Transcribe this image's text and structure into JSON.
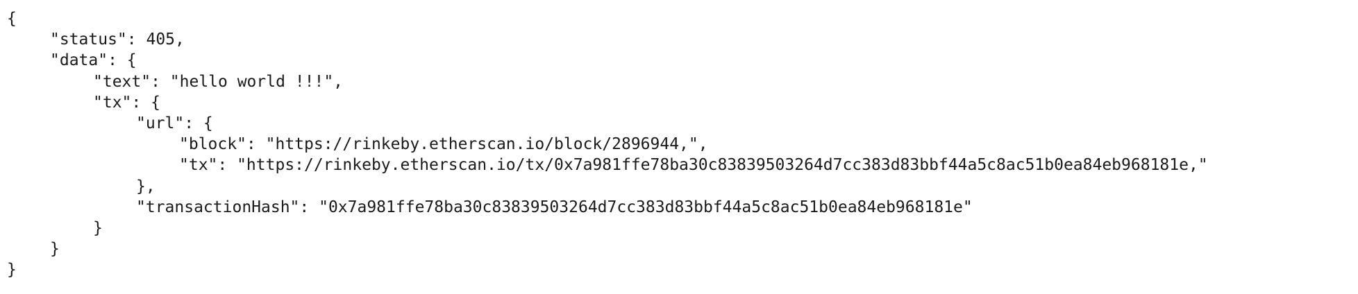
{
  "json_viewer": {
    "lines": [
      "{",
      "\"status\": 405,",
      "\"data\": {",
      "\"text\": \"hello world !!!\",",
      "\"tx\": {",
      "\"url\": {",
      "\"block\": \"https://rinkeby.etherscan.io/block/2896944,\",",
      "\"tx\": \"https://rinkeby.etherscan.io/tx/0x7a981ffe78ba30c83839503264d7cc383d83bbf44a5c8ac51b0ea84eb968181e,\"",
      "},",
      "\"transactionHash\": \"0x7a981ffe78ba30c83839503264d7cc383d83bbf44a5c8ac51b0ea84eb968181e\"",
      "}",
      "}",
      "}"
    ]
  }
}
